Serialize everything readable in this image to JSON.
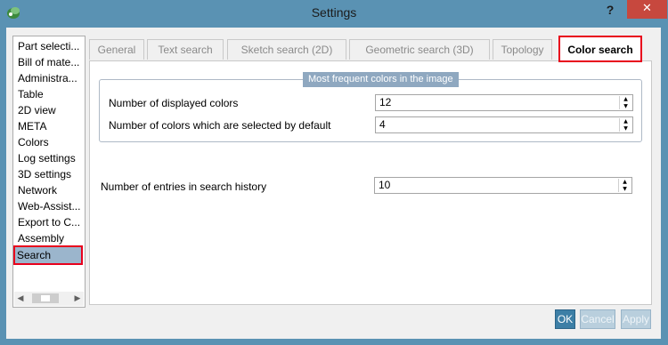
{
  "window": {
    "title": "Settings",
    "help_label": "?",
    "close_label": "✕",
    "app_icon": "app-logo-icon"
  },
  "sidebar": {
    "items": [
      {
        "label": "Part selecti..."
      },
      {
        "label": "Bill of mate..."
      },
      {
        "label": "Administra..."
      },
      {
        "label": "Table"
      },
      {
        "label": "2D view"
      },
      {
        "label": "META"
      },
      {
        "label": "Colors"
      },
      {
        "label": "Log settings"
      },
      {
        "label": "3D settings"
      },
      {
        "label": "Network"
      },
      {
        "label": "Web-Assist..."
      },
      {
        "label": "Export to C..."
      },
      {
        "label": "Assembly"
      },
      {
        "label": "Search",
        "selected": true
      }
    ],
    "scroll_left": "◀",
    "scroll_right": "▶"
  },
  "tabs": [
    {
      "label": "General"
    },
    {
      "label": "Text search"
    },
    {
      "label": "Sketch search (2D)"
    },
    {
      "label": "Geometric search (3D)"
    },
    {
      "label": "Topology"
    },
    {
      "label": "Color search",
      "active": true
    }
  ],
  "group": {
    "title": "Most frequent colors in the image",
    "rows": [
      {
        "label": "Number of displayed colors",
        "value": "12"
      },
      {
        "label": "Number of colors which are selected by default",
        "value": "4"
      }
    ]
  },
  "history": {
    "label": "Number of entries in search history",
    "value": "10"
  },
  "buttons": {
    "ok": "OK",
    "cancel": "Cancel",
    "apply": "Apply"
  },
  "colors": {
    "title_bar": "#5a92b3",
    "close_button": "#c7483e",
    "highlight": "#e8001c",
    "group_title_bg": "#8fa8c0",
    "ok_button": "#3d7fa6"
  }
}
